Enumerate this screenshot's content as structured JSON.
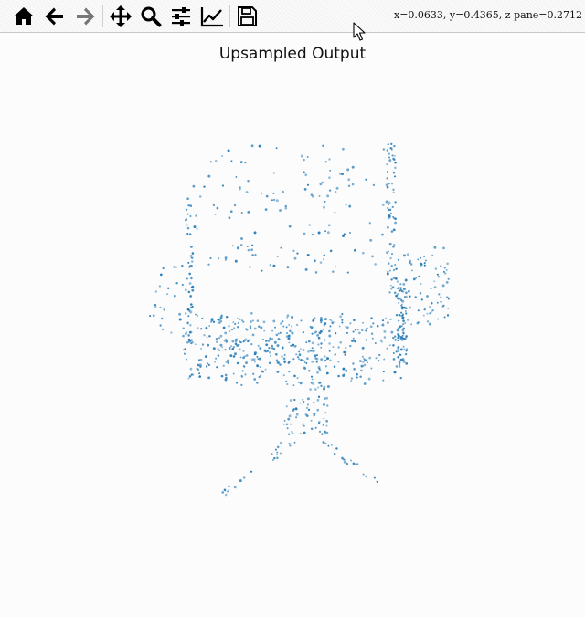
{
  "toolbar": {
    "buttons": [
      {
        "name": "home-button",
        "icon": "home-icon",
        "tooltip": "Reset original view"
      },
      {
        "name": "back-button",
        "icon": "arrow-left-icon",
        "tooltip": "Back to previous view"
      },
      {
        "name": "forward-button",
        "icon": "arrow-right-icon",
        "tooltip": "Forward to next view"
      },
      {
        "name": "pan-button",
        "icon": "move-icon",
        "tooltip": "Pan axes"
      },
      {
        "name": "zoom-button",
        "icon": "zoom-icon",
        "tooltip": "Zoom to rectangle"
      },
      {
        "name": "configure-button",
        "icon": "sliders-icon",
        "tooltip": "Configure subplots"
      },
      {
        "name": "edit-axis-button",
        "icon": "chart-line-icon",
        "tooltip": "Edit axis"
      },
      {
        "name": "save-button",
        "icon": "floppy-disk-icon",
        "tooltip": "Save the figure"
      }
    ],
    "coordinates": "x=0.0633, y=0.4365, z pane=0.2712"
  },
  "plot": {
    "title": "Upsampled Output",
    "point_color": "#1f77b4",
    "background": "#fcfcfc",
    "axes_visible": false
  }
}
